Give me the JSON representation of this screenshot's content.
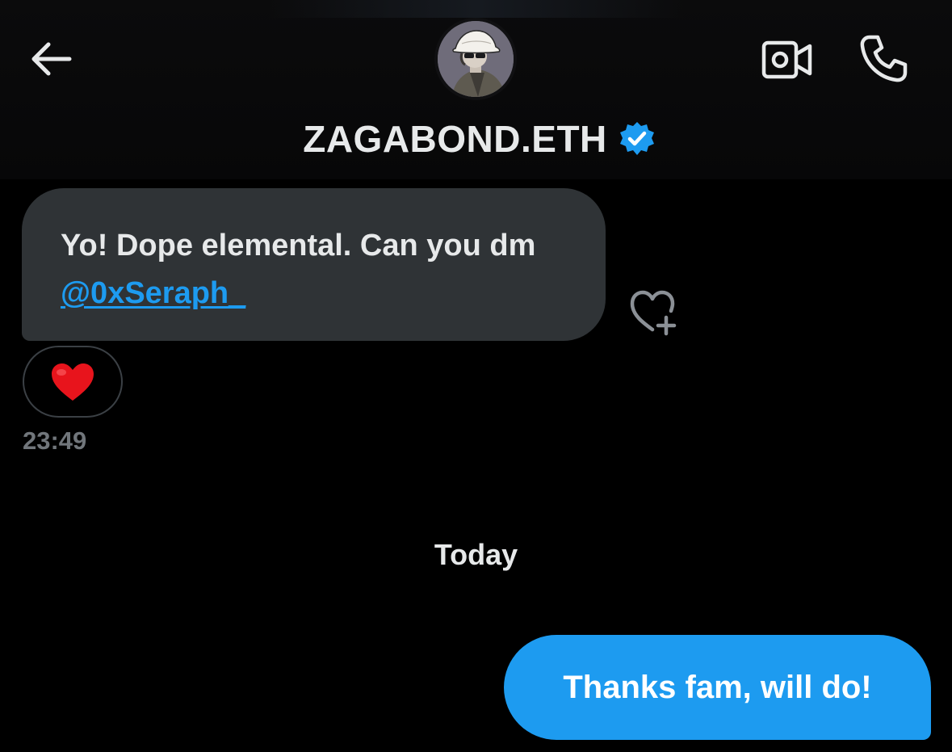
{
  "header": {
    "contact_name": "ZAGABOND.ETH",
    "verified": true,
    "icons": {
      "back": "arrow-left-icon",
      "video": "video-camera-icon",
      "call": "phone-icon",
      "verified": "verified-badge-icon"
    }
  },
  "conversation": {
    "incoming_message": {
      "text_before_mention": "Yo! Dope elemental. Can you dm ",
      "mention": "@0xSeraph_",
      "reaction": "❤️",
      "timestamp": "23:49"
    },
    "date_separator": "Today",
    "outgoing_message": {
      "text": "Thanks fam, will do!"
    }
  },
  "colors": {
    "background": "#000000",
    "incoming_bubble": "#2f3336",
    "outgoing_bubble": "#1d9bf0",
    "accent_link": "#1d9bf0",
    "muted_text": "#71767b",
    "primary_text": "#e7e9ea"
  }
}
